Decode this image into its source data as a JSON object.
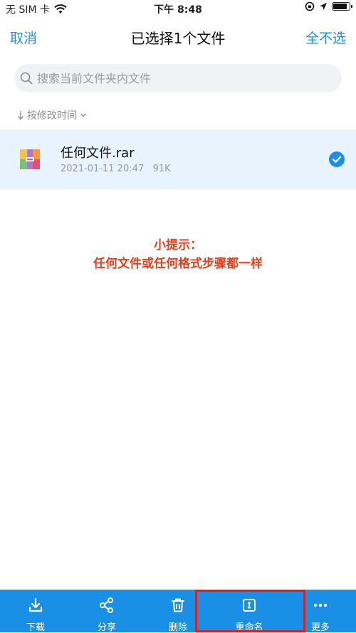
{
  "status_bar": {
    "carrier": "无 SIM 卡",
    "time": "下午 8:48",
    "battery_level": 0.95
  },
  "nav": {
    "cancel_label": "取消",
    "title": "已选择1个文件",
    "deselect_all_label": "全不选"
  },
  "search": {
    "placeholder": "搜索当前文件夹内文件"
  },
  "sort": {
    "label": "按修改时间"
  },
  "files": [
    {
      "name": "任何文件.rar",
      "modified": "2021-01-11 20:47",
      "size": "91K",
      "selected": true
    }
  ],
  "tip": {
    "line1": "小提示：",
    "line2": "任何文件或任何格式步骤都一样"
  },
  "toolbar": {
    "download_label": "下载",
    "share_label": "分享",
    "delete_label": "删除",
    "rename_label": "重命名",
    "more_label": "更多"
  },
  "colors": {
    "accent": "#1a8fe6",
    "tip_red": "#e2401c",
    "highlight": "#e11d1d",
    "selected_row": "#e8f3fd"
  }
}
